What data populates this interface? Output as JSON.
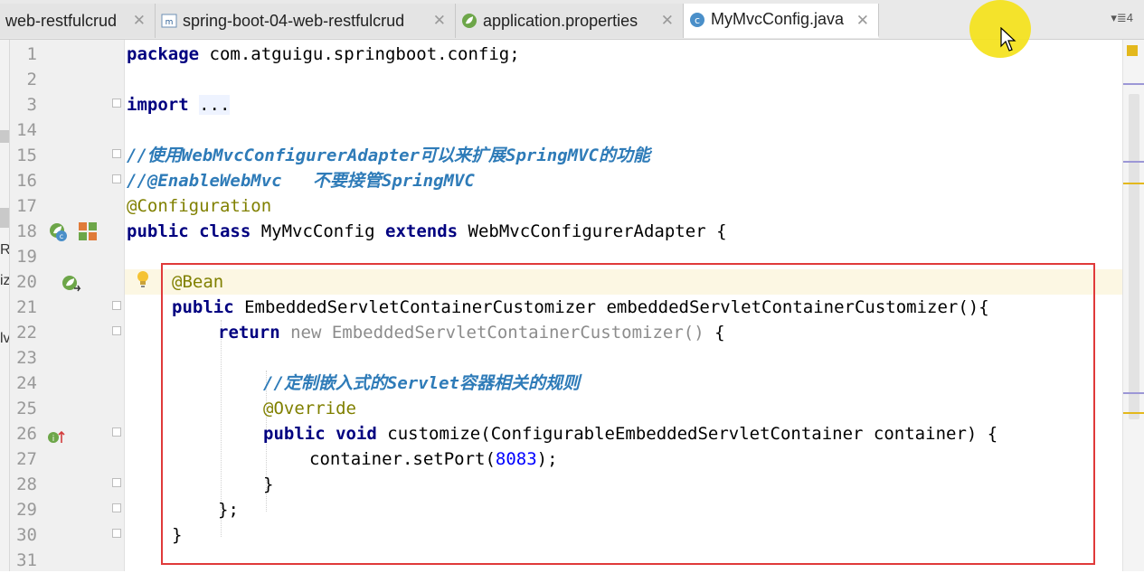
{
  "tabs": [
    {
      "label": "web-restfulcrud",
      "icon": "module-icon",
      "active": false
    },
    {
      "label": "spring-boot-04-web-restfulcrud",
      "icon": "maven-icon",
      "active": false
    },
    {
      "label": "application.properties",
      "icon": "spring-leaf-icon",
      "active": false
    },
    {
      "label": "MyMvcConfig.java",
      "icon": "class-c-icon",
      "active": true
    }
  ],
  "tab_menu_label": "▾≣4",
  "left_strip_chars": [
    "R",
    "iz",
    "lv"
  ],
  "line_numbers": [
    "1",
    "2",
    "3",
    "14",
    "15",
    "16",
    "17",
    "18",
    "19",
    "20",
    "21",
    "22",
    "23",
    "24",
    "25",
    "26",
    "27",
    "28",
    "29",
    "30",
    "31"
  ],
  "code": {
    "line1": {
      "kw": "package",
      "rest": " com.atguigu.springboot.config;"
    },
    "line3": {
      "kw": "import",
      "folded": "..."
    },
    "line15": {
      "prefix": "//使用",
      "em": "WebMvcConfigurerAdapter",
      "mid": "可以来扩展",
      "em2": "SpringMVC",
      "suffix": "的功能"
    },
    "line16": {
      "prefix": "//@EnableWebMvc",
      "mid": "   不要接管",
      "em": "SpringMVC"
    },
    "line17": {
      "ann": "@Configuration"
    },
    "line18": {
      "kw1": "public",
      "kw2": "class",
      "name": " MyMvcConfig ",
      "kw3": "extends",
      "rest": " WebMvcConfigurerAdapter {"
    },
    "line20": {
      "ann": "@Bean"
    },
    "line21": {
      "kw": "public",
      "rest": " EmbeddedServletContainerCustomizer embeddedServletContainerCustomizer(){"
    },
    "line22": {
      "kw": "return",
      "gray": " new EmbeddedServletContainerCustomizer()",
      "rest": " {"
    },
    "line24": {
      "prefix": "//定制嵌入式的",
      "em": "Servlet",
      "suffix": "容器相关的规则"
    },
    "line25": {
      "ann": "@Override"
    },
    "line26": {
      "kw1": "public",
      "kw2": "void",
      "rest": " customize(ConfigurableEmbeddedServletContainer container) {"
    },
    "line27": {
      "pre": "container.setPort(",
      "num": "8083",
      "post": ");"
    },
    "line28": {
      "text": "}"
    },
    "line29": {
      "text": "};"
    },
    "line30": {
      "text": "}"
    }
  },
  "colors": {
    "keyword": "#000080",
    "annotation": "#808000",
    "comment": "#2e7bb8",
    "highlight_box": "#e03a3a",
    "cursor_spot": "#f4e21a"
  }
}
